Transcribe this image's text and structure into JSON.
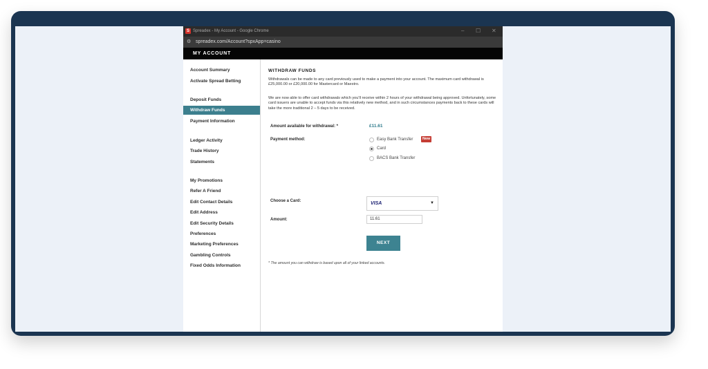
{
  "browser": {
    "window_title": "Spreadex - My Account - Google Chrome",
    "logo_letter": "S",
    "url": "spreadex.com/Account?spxApp=casino",
    "controls": {
      "minimize": "–",
      "maximize": "☐",
      "close": "✕"
    }
  },
  "header": {
    "title": "MY ACCOUNT"
  },
  "sidebar": {
    "items": [
      {
        "label": "Account Summary"
      },
      {
        "label": "Activate Spread Betting"
      },
      {
        "label": "Deposit Funds"
      },
      {
        "label": "Withdraw Funds",
        "active": true
      },
      {
        "label": "Payment Information"
      },
      {
        "label": "Ledger Activity"
      },
      {
        "label": "Trade History"
      },
      {
        "label": "Statements"
      },
      {
        "label": "My Promotions"
      },
      {
        "label": "Refer A Friend"
      },
      {
        "label": "Edit Contact Details"
      },
      {
        "label": "Edit Address"
      },
      {
        "label": "Edit Security Details"
      },
      {
        "label": "Preferences"
      },
      {
        "label": "Marketing Preferences"
      },
      {
        "label": "Gambling Controls"
      },
      {
        "label": "Fixed Odds Information"
      }
    ]
  },
  "main": {
    "heading": "WITHDRAW FUNDS",
    "intro_paragraph": "Withdrawals can be made to any card previously used to make a payment into your account. The maximum card withdrawal is £25,000.00 or £20,000.00 for Mastercard or Maestro.",
    "card_paragraph": "We are now able to offer card withdrawals which you'll receive within 2 hours of your withdrawal being approved. Unfortunately, some card issuers are unable to accept funds via this relatively new method, and in such circumstances payments back to these cards will take the more traditional 2 – 5 days to be received.",
    "amount_available_label": "Amount available for withdrawal: *",
    "amount_available_value": "£11.61",
    "payment_method_label": "Payment method:",
    "payment_methods": [
      {
        "label": "Easy Bank Transfer",
        "badge": "New",
        "selected": false
      },
      {
        "label": "Card",
        "selected": true
      },
      {
        "label": "BACS Bank Transfer",
        "selected": false
      }
    ],
    "choose_card_label": "Choose a Card:",
    "selected_card": "VISA",
    "amount_label": "Amount:",
    "amount_value": "11.61",
    "next_button": "NEXT",
    "footnote": "* The amount you can withdraw is based upon all of your linked accounts."
  },
  "colors": {
    "frame": "#1b3551",
    "accent_teal": "#3c7f8e",
    "badge_red": "#c53d34",
    "amount_teal": "#2f7b8c"
  }
}
